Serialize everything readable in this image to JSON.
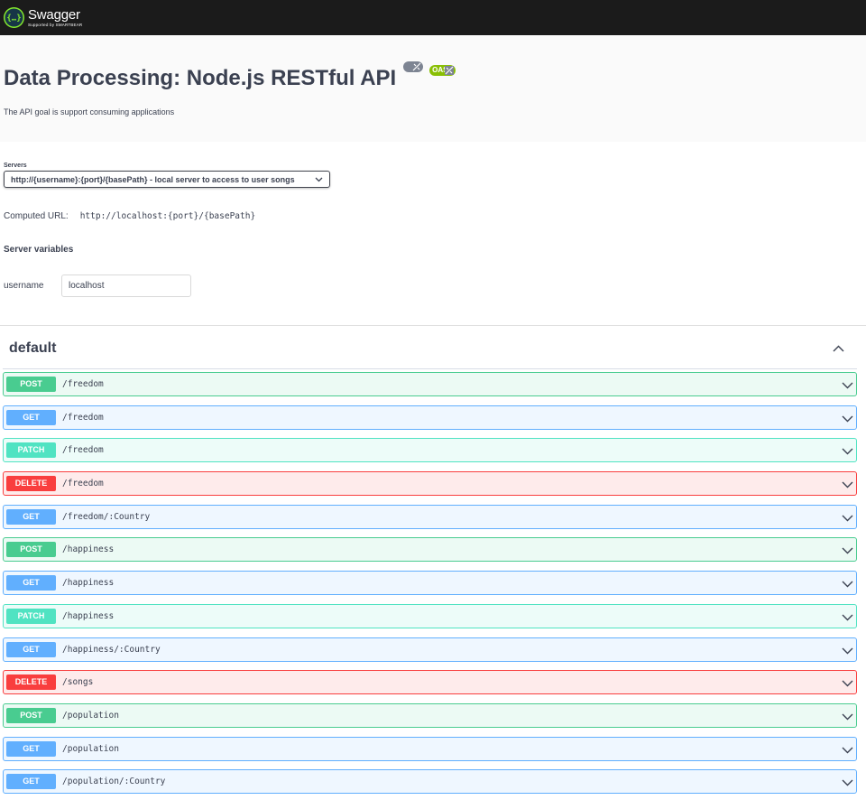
{
  "topbar": {
    "brand": "Swagger",
    "tagline": "Supported by SMARTBEAR"
  },
  "info": {
    "title": "Data Processing: Node.js RESTful API",
    "oas_badge": "OAS",
    "description": "The API goal is support consuming applications"
  },
  "servers": {
    "label": "Servers",
    "selected": "http://{username}:{port}/{basePath} - local server to access to user songs",
    "computed_label": "Computed URL:",
    "computed_url": "http://localhost:{port}/{basePath}",
    "variables_title": "Server variables",
    "variable": {
      "name": "username",
      "value": "localhost"
    }
  },
  "tag": {
    "name": "default",
    "expanded": true
  },
  "operations": [
    {
      "method": "POST",
      "path": "/freedom",
      "color": "#49cc90"
    },
    {
      "method": "GET",
      "path": "/freedom",
      "color": "#61affe"
    },
    {
      "method": "PATCH",
      "path": "/freedom",
      "color": "#50e3c2"
    },
    {
      "method": "DELETE",
      "path": "/freedom",
      "color": "#f93e3e"
    },
    {
      "method": "GET",
      "path": "/freedom/:Country",
      "color": "#61affe"
    },
    {
      "method": "POST",
      "path": "/happiness",
      "color": "#49cc90"
    },
    {
      "method": "GET",
      "path": "/happiness",
      "color": "#61affe"
    },
    {
      "method": "PATCH",
      "path": "/happiness",
      "color": "#50e3c2"
    },
    {
      "method": "GET",
      "path": "/happiness/:Country",
      "color": "#61affe"
    },
    {
      "method": "DELETE",
      "path": "/songs",
      "color": "#f93e3e"
    },
    {
      "method": "POST",
      "path": "/population",
      "color": "#49cc90"
    },
    {
      "method": "GET",
      "path": "/population",
      "color": "#61affe"
    },
    {
      "method": "GET",
      "path": "/population/:Country",
      "color": "#61affe"
    }
  ]
}
